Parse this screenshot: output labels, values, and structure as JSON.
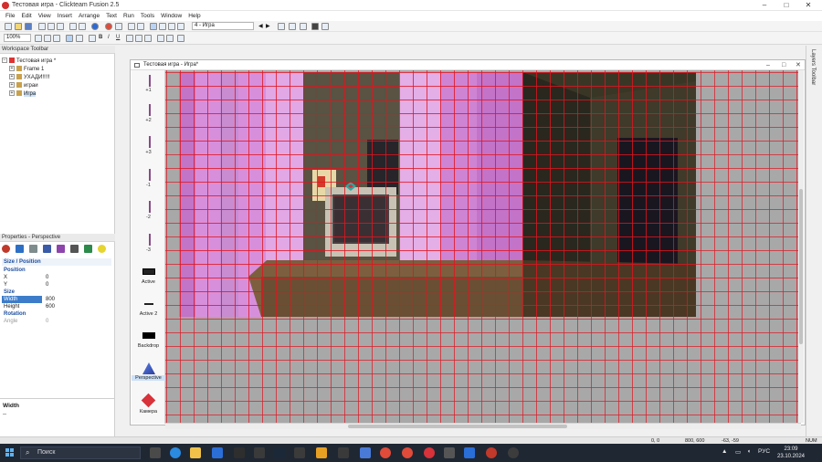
{
  "window": {
    "title": "Тестовая игра - Clickteam Fusion 2.5",
    "controls": [
      "–",
      "□",
      "✕"
    ]
  },
  "menu": [
    "File",
    "Edit",
    "View",
    "Insert",
    "Arrange",
    "Text",
    "Run",
    "Tools",
    "Window",
    "Help"
  ],
  "toolbar": {
    "frame_combo": "4 - Игра",
    "zoom_combo": "100%"
  },
  "workspace": {
    "title": "Workspace Toolbar",
    "tree": [
      {
        "label": "Тестовая игра *",
        "level": 0,
        "expander": "−",
        "selected": false
      },
      {
        "label": "Frame 1",
        "level": 1,
        "expander": "+",
        "selected": false
      },
      {
        "label": "УХАДИ!!!!!",
        "level": 1,
        "expander": "+",
        "selected": false
      },
      {
        "label": "играи",
        "level": 1,
        "expander": "+",
        "selected": false
      },
      {
        "label": "Игра",
        "level": 1,
        "expander": "+",
        "selected": true
      }
    ]
  },
  "properties": {
    "title": "Properties - Perspective",
    "rows": [
      {
        "type": "group",
        "label": "Size / Position"
      },
      {
        "type": "group",
        "label": "Position"
      },
      {
        "type": "field",
        "label": "X",
        "value": "0"
      },
      {
        "type": "field",
        "label": "Y",
        "value": "0"
      },
      {
        "type": "group",
        "label": "Size"
      },
      {
        "type": "field",
        "label": "Width",
        "value": "800",
        "selected": true
      },
      {
        "type": "field",
        "label": "Height",
        "value": "600"
      },
      {
        "type": "group",
        "label": "Rotation"
      },
      {
        "type": "field",
        "label": "Angle",
        "value": "0",
        "disabled": true
      }
    ],
    "help_title": "Width",
    "help_text": "--"
  },
  "frame_editor": {
    "title": "Тестовая игра - Игра*",
    "layers": [
      "+1",
      "+2",
      "+3",
      "-1",
      "-2",
      "-3"
    ],
    "objects": [
      "Active",
      "Active 2",
      "Backdrop",
      "Perspective",
      "Камера"
    ]
  },
  "right_dock": {
    "label": "Layers Toolbar"
  },
  "statusbar": {
    "left": "0, 0",
    "size": "800, 600",
    "coords": "-63, -59",
    "indicator": "NUM"
  },
  "taskbar": {
    "search_placeholder": "Поиск",
    "language": "РУС",
    "time": "23:09",
    "date": "23.10.2024"
  },
  "colors": {
    "grid": "#dc1e28",
    "pink_wall": "#d58ed6",
    "room_dark": "#3a3326",
    "desk": "#6b5238",
    "canvas_bg": "#a8a8a8"
  }
}
